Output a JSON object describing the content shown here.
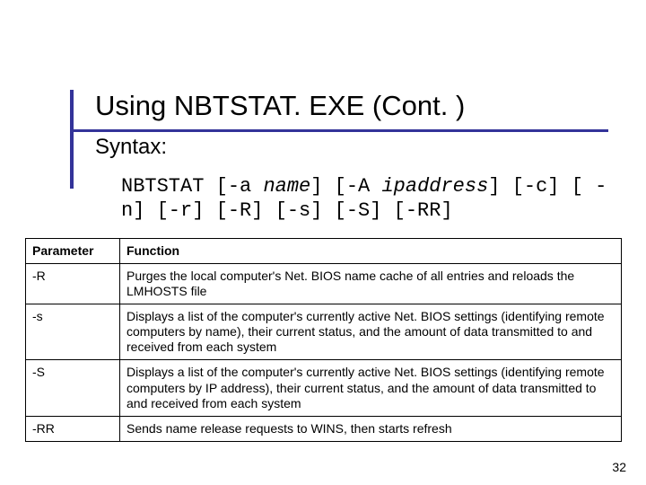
{
  "title": "Using NBTSTAT. EXE (Cont. )",
  "subtitle": "Syntax:",
  "syntax": {
    "s1": "NBTSTAT [-a ",
    "i1": "name",
    "s2": "] [-A ",
    "i2": "ipaddress",
    "s3": "] [-c] [ -n] [-r] [-R] [-s] [-S] [-RR]"
  },
  "table": {
    "headers": {
      "param": "Parameter",
      "func": "Function"
    },
    "rows": [
      {
        "param": "-R",
        "func": "Purges the local computer's Net. BIOS name cache of all entries and reloads the LMHOSTS file"
      },
      {
        "param": "-s",
        "func": "Displays a list of the computer's currently active Net. BIOS settings (identifying remote computers by name), their current status, and the amount of data transmitted to and received from each system"
      },
      {
        "param": "-S",
        "func": "Displays a list of the computer's currently active Net. BIOS settings (identifying remote computers by IP address), their current status, and the amount of data transmitted to and received from each system"
      },
      {
        "param": "-RR",
        "func": "Sends name release requests to WINS, then starts refresh"
      }
    ]
  },
  "page_number": "32"
}
